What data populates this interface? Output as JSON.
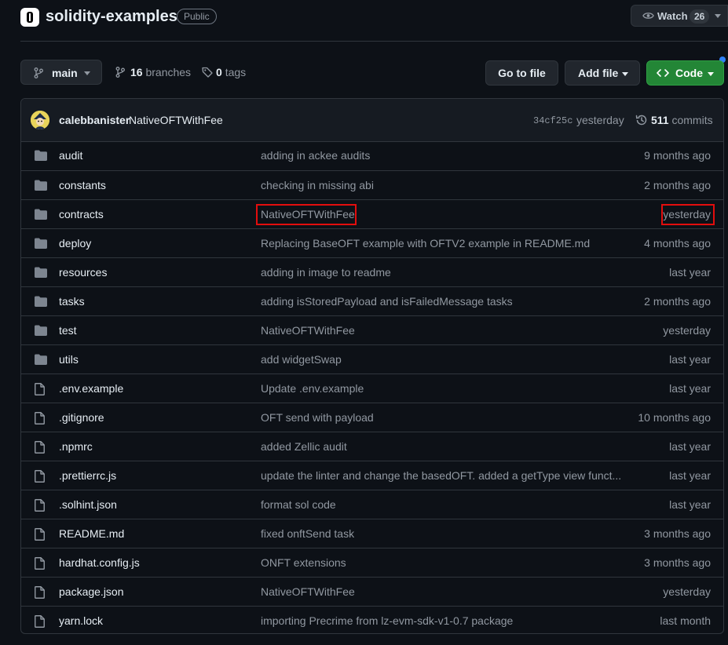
{
  "repo": {
    "name": "solidity-examples",
    "visibility": "Public"
  },
  "watch": {
    "label": "Watch",
    "count": "26"
  },
  "toolbar": {
    "branch": "main",
    "branches_count": "16",
    "branches_label": "branches",
    "tags_count": "0",
    "tags_label": "tags",
    "goto_file": "Go to file",
    "add_file": "Add file",
    "code": "Code"
  },
  "latest_commit": {
    "author": "calebbanister",
    "message": "NativeOFTWithFee",
    "sha": "34cf25c",
    "time": "yesterday",
    "commits_count": "511",
    "commits_label": "commits"
  },
  "files": [
    {
      "type": "dir",
      "name": "audit",
      "message": "adding in ackee audits",
      "time": "9 months ago"
    },
    {
      "type": "dir",
      "name": "constants",
      "message": "checking in missing abi",
      "time": "2 months ago"
    },
    {
      "type": "dir",
      "name": "contracts",
      "message": "NativeOFTWithFee",
      "time": "yesterday"
    },
    {
      "type": "dir",
      "name": "deploy",
      "message": "Replacing BaseOFT example with OFTV2 example in README.md",
      "time": "4 months ago"
    },
    {
      "type": "dir",
      "name": "resources",
      "message": "adding in image to readme",
      "time": "last year"
    },
    {
      "type": "dir",
      "name": "tasks",
      "message": "adding isStoredPayload and isFailedMessage tasks",
      "time": "2 months ago"
    },
    {
      "type": "dir",
      "name": "test",
      "message": "NativeOFTWithFee",
      "time": "yesterday"
    },
    {
      "type": "dir",
      "name": "utils",
      "message": "add widgetSwap",
      "time": "last year"
    },
    {
      "type": "file",
      "name": ".env.example",
      "message": "Update .env.example",
      "time": "last year"
    },
    {
      "type": "file",
      "name": ".gitignore",
      "message": "OFT send with payload",
      "time": "10 months ago"
    },
    {
      "type": "file",
      "name": ".npmrc",
      "message": "added Zellic audit",
      "time": "last year"
    },
    {
      "type": "file",
      "name": ".prettierrc.js",
      "message": "update the linter and change the basedOFT. added a getType view funct...",
      "time": "last year"
    },
    {
      "type": "file",
      "name": ".solhint.json",
      "message": "format sol code",
      "time": "last year"
    },
    {
      "type": "file",
      "name": "README.md",
      "message": "fixed onftSend task",
      "time": "3 months ago"
    },
    {
      "type": "file",
      "name": "hardhat.config.js",
      "message": "ONFT extensions",
      "time": "3 months ago"
    },
    {
      "type": "file",
      "name": "package.json",
      "message": "NativeOFTWithFee",
      "time": "yesterday"
    },
    {
      "type": "file",
      "name": "yarn.lock",
      "message": "importing Precrime from lz-evm-sdk-v1-0.7 package",
      "time": "last month"
    }
  ],
  "icons": {
    "dir": "folder-icon",
    "file": "file-icon"
  },
  "colors": {
    "background": "#0d1117",
    "code_button": "#238636",
    "highlight": "#e30d0d",
    "folder": "#7d8590"
  }
}
